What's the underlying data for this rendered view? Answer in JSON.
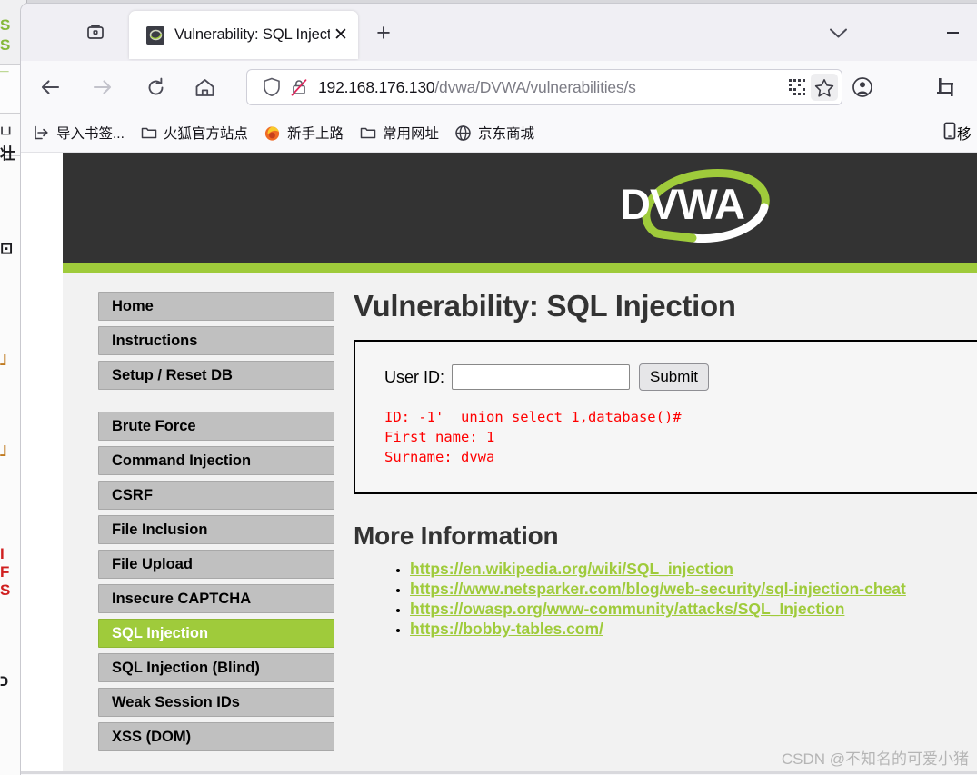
{
  "browser": {
    "window_controls": {
      "minimize": "—",
      "tab_list": "chevron-down"
    },
    "tab": {
      "title": "Vulnerability: SQL Injection ::",
      "close_label": "✕",
      "favicon": "dvwa-favicon"
    },
    "new_tab_label": "+",
    "toolbar": {
      "back": "back-arrow",
      "forward": "forward-arrow",
      "reload": "reload-arrow",
      "home": "home-house"
    },
    "urlbar": {
      "shield_icon": "tracking-protection-shield",
      "lock_icon": "lock-crossed-out",
      "url_host": "192.168.176.130",
      "url_path": "/dvwa/DVWA/vulnerabilities/s",
      "qr_icon": "qr-code-icon",
      "bookmark_icon": "star-icon"
    },
    "account_icon": "account-circle-icon",
    "screenshot_icon": "crop-screenshot-icon",
    "overflow_icon": "left-arrow-icon",
    "bookmarks": [
      {
        "label": "导入书签...",
        "icon": "import-bookmarks-icon"
      },
      {
        "label": "火狐官方站点",
        "icon": "folder-icon"
      },
      {
        "label": "新手上路",
        "icon": "firefox-icon"
      },
      {
        "label": "常用网址",
        "icon": "folder-icon"
      },
      {
        "label": "京东商城",
        "icon": "globe-icon"
      }
    ],
    "bookmarks_overflow": {
      "label": "移",
      "icon": "mobile-phone-icon"
    }
  },
  "dvwa": {
    "logo_text": "DVWA",
    "colors": {
      "header_bg": "#333333",
      "accent_green": "#9fcb3b",
      "body_bg": "#f2f2f2",
      "menu_bg": "#c0c0c0",
      "result_red": "#ff0000"
    },
    "sidebar": [
      {
        "label": "Home",
        "active": false
      },
      {
        "label": "Instructions",
        "active": false
      },
      {
        "label": "Setup / Reset DB",
        "active": false
      },
      {
        "label": "Brute Force",
        "active": false
      },
      {
        "label": "Command Injection",
        "active": false
      },
      {
        "label": "CSRF",
        "active": false
      },
      {
        "label": "File Inclusion",
        "active": false
      },
      {
        "label": "File Upload",
        "active": false
      },
      {
        "label": "Insecure CAPTCHA",
        "active": false
      },
      {
        "label": "SQL Injection",
        "active": true
      },
      {
        "label": "SQL Injection (Blind)",
        "active": false
      },
      {
        "label": "Weak Session IDs",
        "active": false
      },
      {
        "label": "XSS (DOM)",
        "active": false
      }
    ],
    "page_title": "Vulnerability: SQL Injection",
    "form": {
      "label": "User ID:",
      "input_value": "",
      "input_placeholder": "",
      "submit_label": "Submit"
    },
    "result_lines": [
      "ID: -1'  union select 1,database()#",
      "First name: 1",
      "Surname: dvwa"
    ],
    "more_information_title": "More Information",
    "links": [
      "https://en.wikipedia.org/wiki/SQL_injection",
      "https://www.netsparker.com/blog/web-security/sql-injection-cheat",
      "https://owasp.org/www-community/attacks/SQL_Injection",
      "https://bobby-tables.com/"
    ]
  },
  "watermark": "CSDN @不知名的可爱小猪"
}
